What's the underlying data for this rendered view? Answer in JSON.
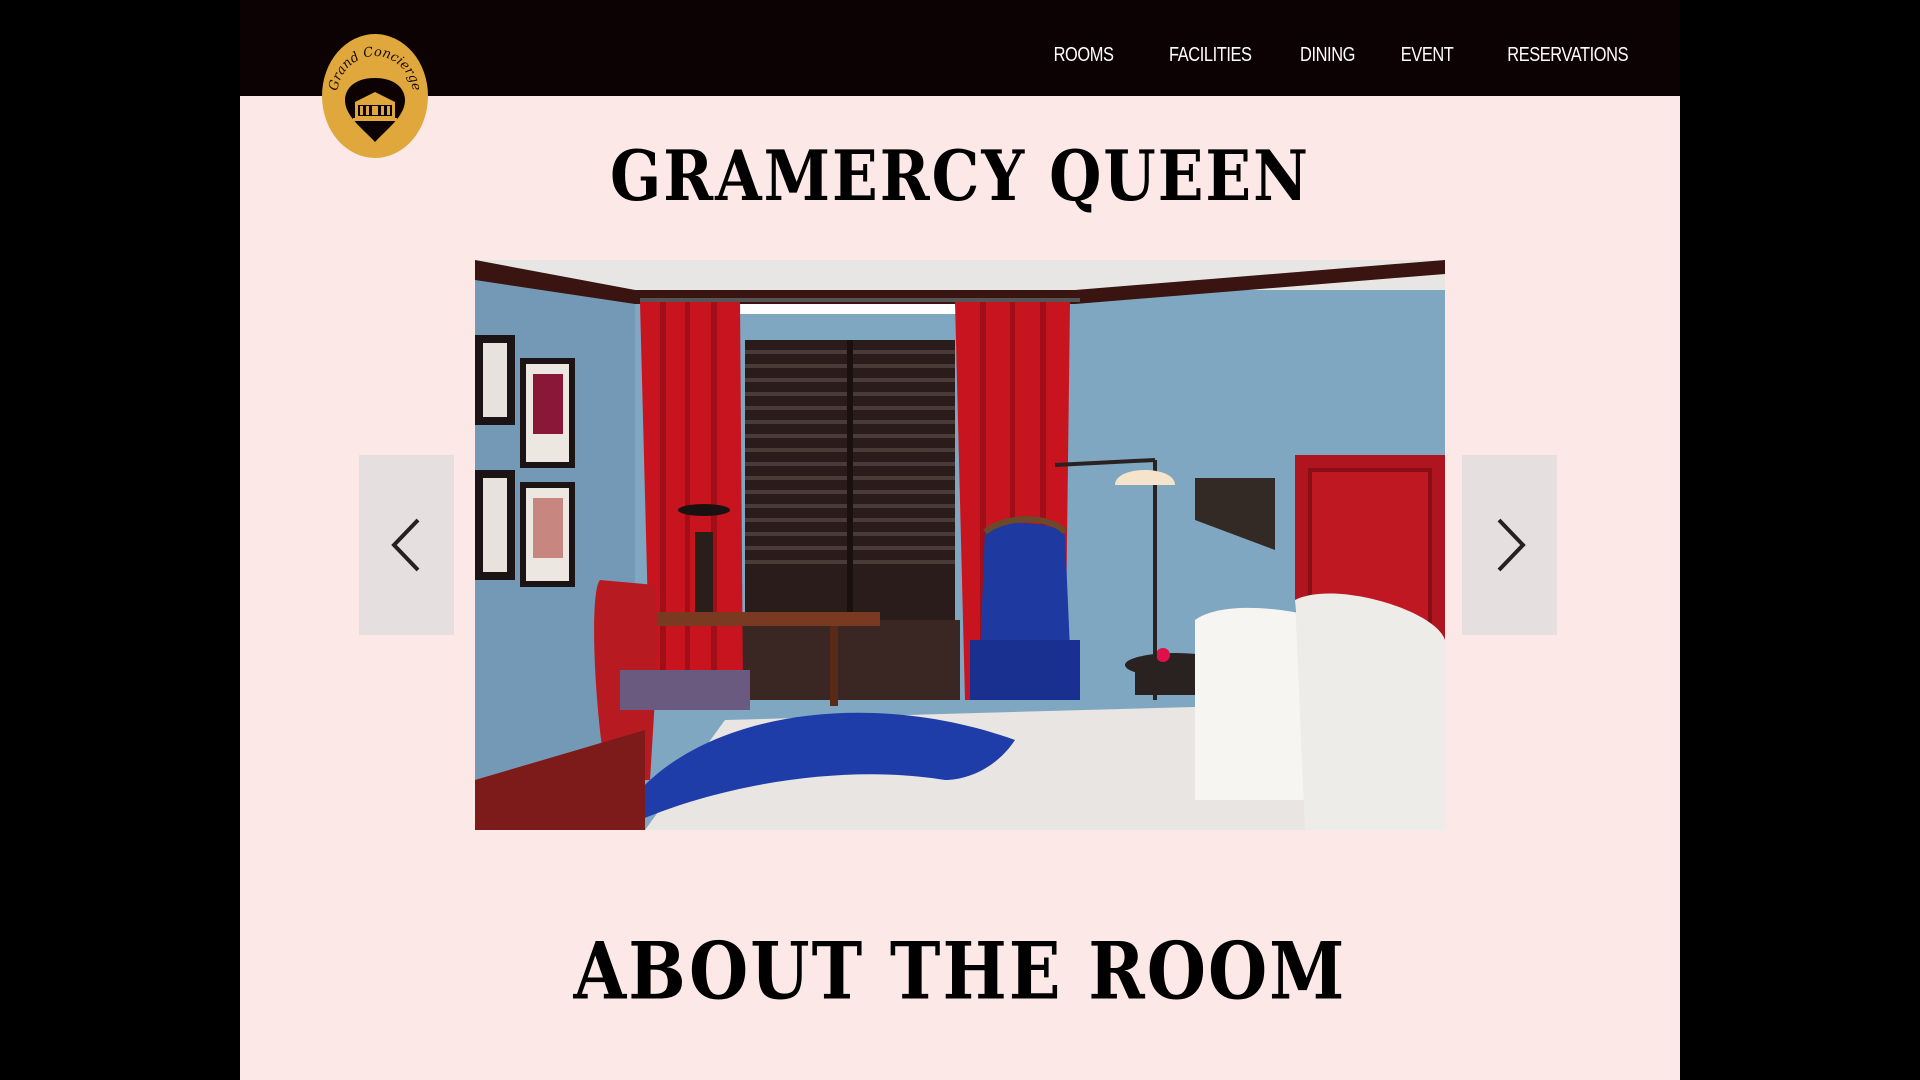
{
  "brand": {
    "logo_text": "Grand Concierge"
  },
  "nav": {
    "items": [
      {
        "label": "ROOMS"
      },
      {
        "label": "FACILITIES"
      },
      {
        "label": "DINING"
      },
      {
        "label": "EVENT"
      },
      {
        "label": "RESERVATIONS"
      }
    ]
  },
  "room": {
    "title": "GRAMERCY QUEEN"
  },
  "about": {
    "heading": "ABOUT THE ROOM"
  },
  "colors": {
    "topbar": "#0c0204",
    "page_background": "#fde8e8",
    "logo_gold": "#e0a83c",
    "arrow_background": "#e6dfe0"
  },
  "icons": {
    "prev": "chevron-left-icon",
    "next": "chevron-right-icon",
    "logo": "hotel-pin-icon"
  }
}
